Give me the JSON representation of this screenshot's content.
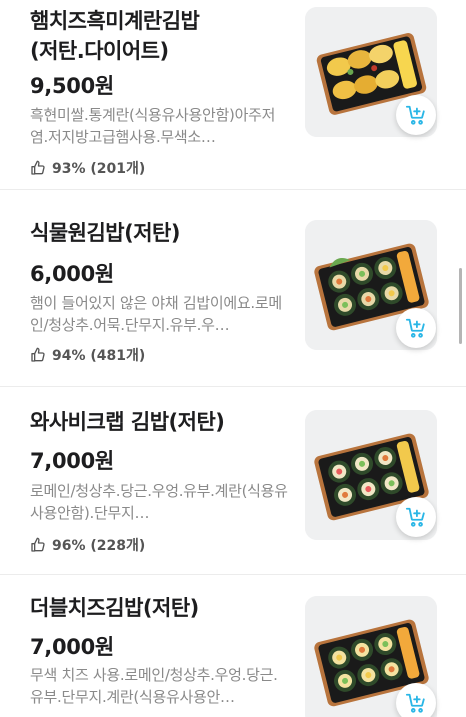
{
  "items": [
    {
      "name": "햄치즈흑미계란김밥\n(저탄.다이어트)",
      "price": "9,500원",
      "description": "흑현미쌀.통계란(식용유사용안함)아주저염.저지방고급햄사용.무색소…",
      "rating": "93% (201개)",
      "image_icon": "kimbap-box-photo"
    },
    {
      "name": "식물원김밥(저탄)",
      "price": "6,000원",
      "description": "햄이 들어있지 않은 야채 김밥이에요.로메인/청상추.어묵.단무지.유부.우…",
      "rating": "94% (481개)",
      "image_icon": "kimbap-box-photo"
    },
    {
      "name": "와사비크랩 김밥(저탄)",
      "price": "7,000원",
      "description": "로메인/청상추.당근.우엉.유부.계란(식용유사용안함).단무지…",
      "rating": "96% (228개)",
      "image_icon": "kimbap-box-photo"
    },
    {
      "name": "더블치즈김밥(저탄)",
      "price": "7,000원",
      "description": "무색 치즈 사용.로메인/청상추.우엉.당근.유부.단무지.계란(식용유사용안…",
      "rating": "",
      "image_icon": "kimbap-box-photo"
    }
  ],
  "icons": {
    "rating": "thumbs-up-icon",
    "cart": "add-to-cart-icon"
  },
  "colors": {
    "accent": "#2ab6e6",
    "text": "#1d1d1f",
    "muted": "#8a8a8a"
  }
}
